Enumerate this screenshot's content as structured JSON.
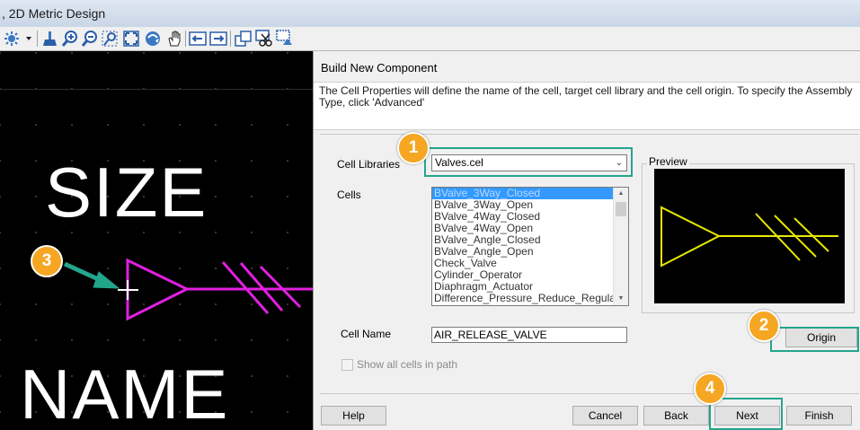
{
  "window": {
    "title": ", 2D Metric Design"
  },
  "toolbar": {
    "icons": [
      "settings-dropdown-icon",
      "fit-brush-icon",
      "zoom-in-icon",
      "zoom-out-icon",
      "window-area-icon",
      "fit-view-icon",
      "rotate-view-icon",
      "pan-view-icon",
      "previous-view-icon",
      "next-view-icon",
      "copy-view-icon",
      "cut-view-icon",
      "update-view-icon"
    ]
  },
  "canvas": {
    "label_size": "SIZE",
    "label_name": "NAME",
    "symbol_color": "#e020e0"
  },
  "dialog": {
    "title": "Build New Component",
    "description": "The Cell Properties will define the name of the cell, target cell library and the cell origin.  To specify the Assembly Type, click 'Advanced'",
    "cell_libraries_label": "Cell Libraries",
    "cell_libraries_value": "Valves.cel",
    "cells_label": "Cells",
    "cells": [
      "BValve_3Way_Closed",
      "BValve_3Way_Open",
      "BValve_4Way_Closed",
      "BValve_4Way_Open",
      "BValve_Angle_Closed",
      "BValve_Angle_Open",
      "Check_Valve",
      "Cylinder_Operator",
      "Diaphragm_Actuator",
      "Difference_Pressure_Reduce_Regulator"
    ],
    "selected_cell_index": 0,
    "preview_label": "Preview",
    "preview_color": "#e8e800",
    "cell_name_label": "Cell Name",
    "cell_name_value": "AIR_RELEASE_VALVE",
    "origin_button": "Origin",
    "show_all_label": "Show all cells in path",
    "buttons": {
      "help": "Help",
      "cancel": "Cancel",
      "back": "Back",
      "next": "Next",
      "finish": "Finish"
    }
  },
  "callouts": {
    "c1": "1",
    "c2": "2",
    "c3": "3",
    "c4": "4"
  },
  "highlight_color": "#23a58c",
  "callout_color": "#f5a623"
}
